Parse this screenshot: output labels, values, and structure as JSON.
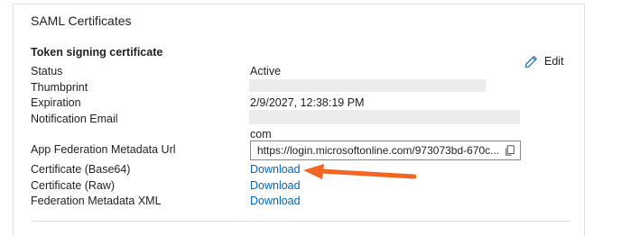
{
  "panel": {
    "title": "SAML Certificates",
    "section_title": "Token signing certificate",
    "edit_label": "Edit"
  },
  "fields": {
    "status": {
      "label": "Status",
      "value": "Active"
    },
    "thumbprint": {
      "label": "Thumbprint"
    },
    "expiration": {
      "label": "Expiration",
      "value": "2/9/2027, 12:38:19 PM"
    },
    "notification_email": {
      "label": "Notification Email",
      "value_suffix": "com"
    },
    "metadata_url": {
      "label": "App Federation Metadata Url",
      "value": "https://login.microsoftonline.com/973073bd-670c..."
    },
    "cert_base64": {
      "label": "Certificate (Base64)",
      "link": "Download"
    },
    "cert_raw": {
      "label": "Certificate (Raw)",
      "link": "Download"
    },
    "federation_xml": {
      "label": "Federation Metadata XML",
      "link": "Download"
    }
  },
  "colors": {
    "link": "#0067b8",
    "annotation_arrow": "#f26522",
    "redaction": "#ececec",
    "border": "#e1dfdd"
  },
  "icons": {
    "edit": "pencil-icon",
    "copy": "copy-icon"
  }
}
